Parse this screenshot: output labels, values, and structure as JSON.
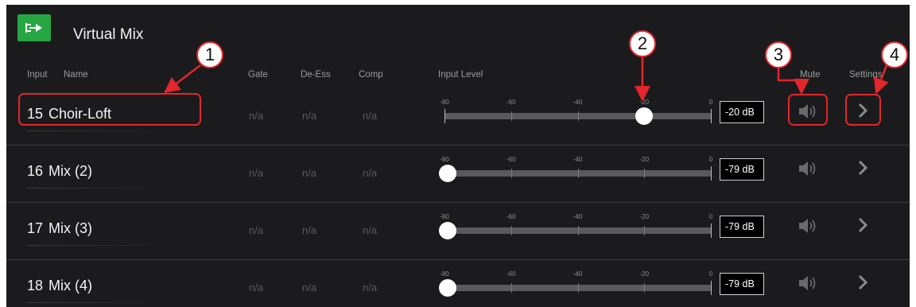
{
  "app": {
    "title": "Virtual Mix"
  },
  "headers": {
    "input": "Input",
    "name": "Name",
    "gate": "Gate",
    "deess": "De-Ess",
    "comp": "Comp",
    "input_level": "Input Level",
    "mute": "Mute",
    "settings": "Settings"
  },
  "scale_ticks": [
    "-80",
    "-60",
    "-40",
    "-20",
    "0"
  ],
  "scale": {
    "min_db": -80,
    "max_db": 0
  },
  "rows": [
    {
      "input": "15",
      "name": "Choir-Loft",
      "gate": "n/a",
      "deess": "n/a",
      "comp": "n/a",
      "level_db": -20,
      "level_text": "-20 dB"
    },
    {
      "input": "16",
      "name": "Mix (2)",
      "gate": "n/a",
      "deess": "n/a",
      "comp": "n/a",
      "level_db": -79,
      "level_text": "-79 dB"
    },
    {
      "input": "17",
      "name": "Mix (3)",
      "gate": "n/a",
      "deess": "n/a",
      "comp": "n/a",
      "level_db": -79,
      "level_text": "-79 dB"
    },
    {
      "input": "18",
      "name": "Mix (4)",
      "gate": "n/a",
      "deess": "n/a",
      "comp": "n/a",
      "level_db": -79,
      "level_text": "-79 dB"
    }
  ],
  "callouts": [
    "1",
    "2",
    "3",
    "4"
  ],
  "colors": {
    "logo": "#27a644",
    "callout": "#e2262b",
    "background": "#1b1b1d"
  },
  "icons": {
    "logo": "input-arrow-icon",
    "mute": "speaker-icon",
    "settings": "chevron-right-icon"
  }
}
